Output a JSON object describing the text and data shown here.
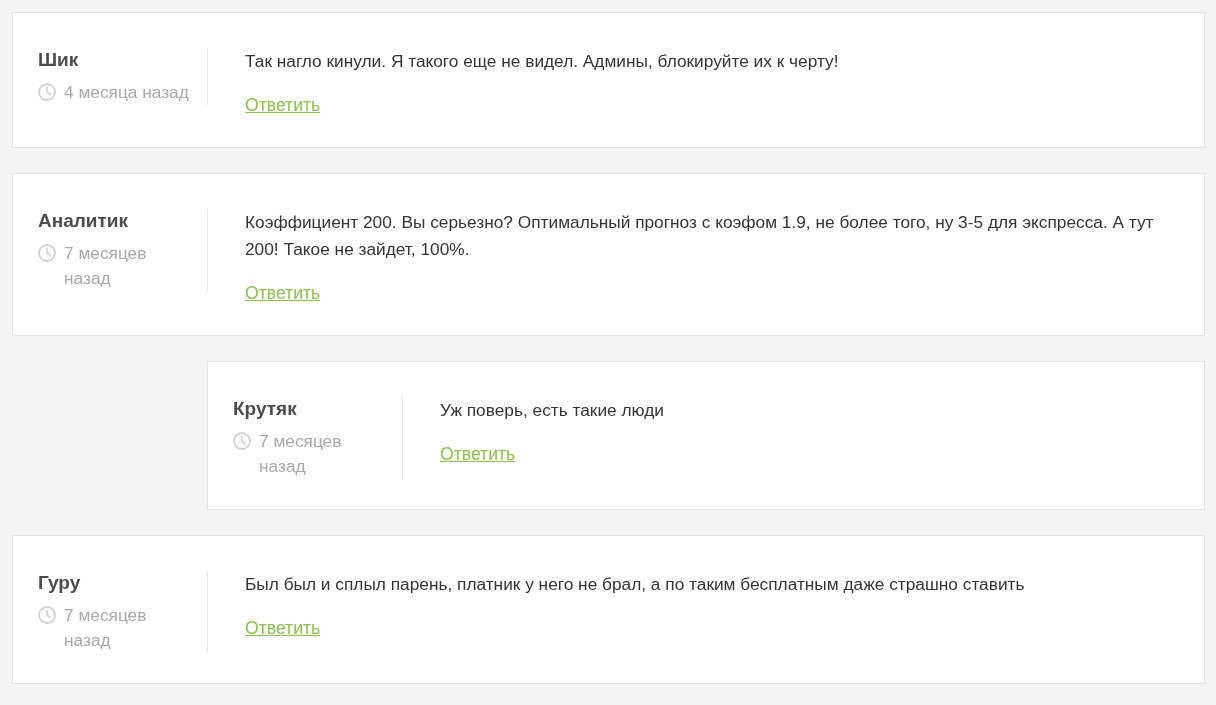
{
  "comments": [
    {
      "author": "Шик",
      "time": "4 месяца назад",
      "text": "Так нагло кинули. Я такого еще не видел. Админы, блокируйте их к черту!",
      "reply_link": "Ответить"
    },
    {
      "author": "Аналитик",
      "time": "7 месяцев назад",
      "text": "Коэффициент 200. Вы серьезно? Оптимальный прогноз с коэфом 1.9, не более того, ну 3-5 для экспресса. А тут 200! Такое не зайдет, 100%.",
      "reply_link": "Ответить",
      "replies": [
        {
          "author": "Крутяк",
          "time": "7 месяцев назад",
          "text": "Уж поверь, есть такие люди",
          "reply_link": "Ответить"
        }
      ]
    },
    {
      "author": "Гуру",
      "time": "7 месяцев назад",
      "text": "Был был и сплыл парень, платник у него не брал, а по таким бесплатным даже страшно ставить",
      "reply_link": "Ответить"
    }
  ]
}
